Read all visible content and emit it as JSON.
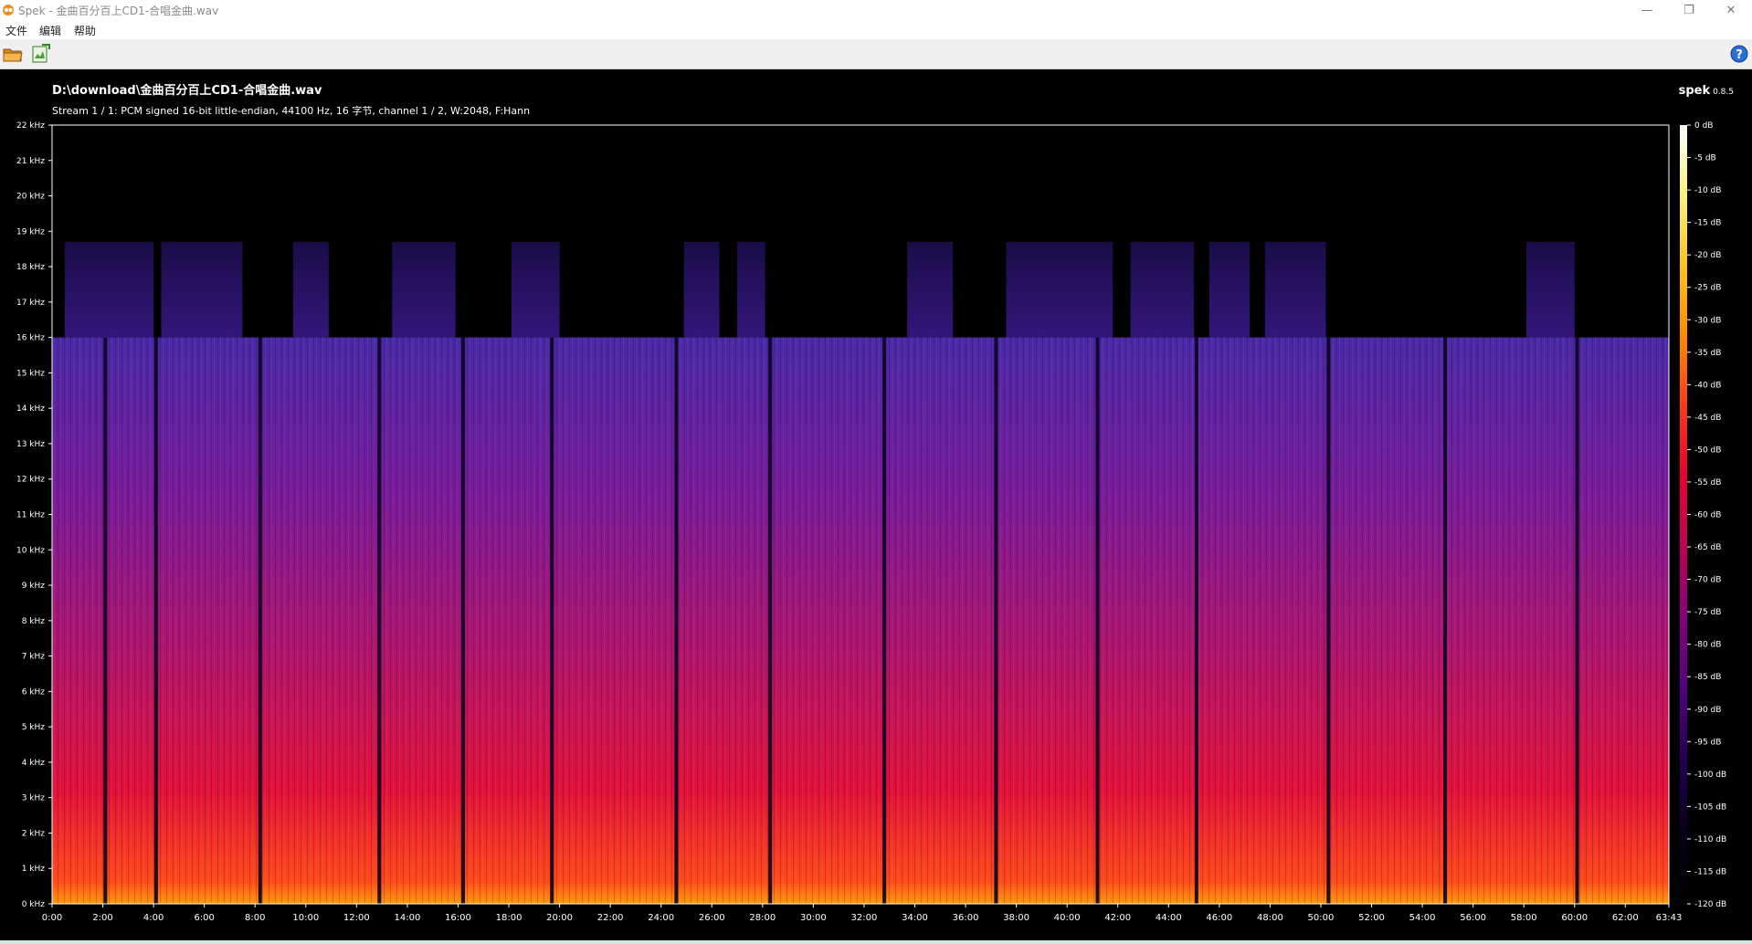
{
  "window": {
    "title": "Spek - 金曲百分百上CD1-合唱金曲.wav",
    "icon": "spek-app-icon",
    "controls": {
      "minimize": "—",
      "restore": "❐",
      "close": "✕"
    }
  },
  "menu": {
    "items": [
      "文件",
      "编辑",
      "帮助"
    ]
  },
  "toolbar": {
    "buttons": [
      {
        "name": "open-file-icon",
        "tooltip": ""
      },
      {
        "name": "save-image-icon",
        "tooltip": ""
      }
    ],
    "help": "help-icon"
  },
  "header": {
    "file_path": "D:\\download\\金曲百分百上CD1-合唱金曲.wav",
    "stream_info": "Stream 1 / 1: PCM signed 16-bit little-endian, 44100 Hz, 16 字节, channel 1 / 2, W:2048, F:Hann",
    "brand": "spek",
    "version": "0.8.5"
  },
  "chart_data": {
    "type": "heatmap",
    "title": "",
    "y_axis": {
      "unit": "kHz",
      "ticks": [
        "0 kHz",
        "1 kHz",
        "2 kHz",
        "3 kHz",
        "4 kHz",
        "5 kHz",
        "6 kHz",
        "7 kHz",
        "8 kHz",
        "9 kHz",
        "10 kHz",
        "11 kHz",
        "12 kHz",
        "13 kHz",
        "14 kHz",
        "15 kHz",
        "16 kHz",
        "17 kHz",
        "18 kHz",
        "19 kHz",
        "20 kHz",
        "21 kHz",
        "22 kHz"
      ],
      "range": [
        0,
        22
      ]
    },
    "x_axis": {
      "ticks": [
        "0:00",
        "2:00",
        "4:00",
        "6:00",
        "8:00",
        "10:00",
        "12:00",
        "14:00",
        "16:00",
        "18:00",
        "20:00",
        "22:00",
        "24:00",
        "26:00",
        "28:00",
        "30:00",
        "32:00",
        "34:00",
        "36:00",
        "38:00",
        "40:00",
        "42:00",
        "44:00",
        "46:00",
        "48:00",
        "50:00",
        "52:00",
        "54:00",
        "56:00",
        "58:00",
        "60:00",
        "62:00",
        "63:43"
      ],
      "range_seconds": [
        0,
        3823
      ]
    },
    "color_scale": {
      "unit": "dB",
      "range": [
        -120,
        0
      ],
      "ticks": [
        "0 dB",
        "-5 dB",
        "-10 dB",
        "-15 dB",
        "-20 dB",
        "-25 dB",
        "-30 dB",
        "-35 dB",
        "-40 dB",
        "-45 dB",
        "-50 dB",
        "-55 dB",
        "-60 dB",
        "-65 dB",
        "-70 dB",
        "-75 dB",
        "-80 dB",
        "-85 dB",
        "-90 dB",
        "-95 dB",
        "-100 dB",
        "-105 dB",
        "-110 dB",
        "-115 dB",
        "-120 dB"
      ],
      "colors": [
        "#ffffff",
        "#fff07a",
        "#ffc21f",
        "#ff8a00",
        "#ff3a1a",
        "#e8002e",
        "#b8005a",
        "#80007e",
        "#4e0080",
        "#200050",
        "#06001a",
        "#000000"
      ]
    },
    "lowpass_cutoff_khz": 16,
    "track_boundaries_min": [
      2.1,
      4.1,
      8.2,
      12.9,
      16.2,
      19.7,
      24.6,
      28.3,
      32.8,
      37.2,
      41.2,
      45.1,
      50.3,
      54.9,
      60.1
    ],
    "high_band_segments_min": [
      [
        0.5,
        4.0
      ],
      [
        4.3,
        7.5
      ],
      [
        9.5,
        10.9
      ],
      [
        13.4,
        15.9
      ],
      [
        18.1,
        20.0
      ],
      [
        24.9,
        26.3
      ],
      [
        27.0,
        28.1
      ],
      [
        33.7,
        35.5
      ],
      [
        37.6,
        41.8
      ],
      [
        42.5,
        45.0
      ],
      [
        45.6,
        47.2
      ],
      [
        47.8,
        50.2
      ],
      [
        58.1,
        60.0
      ]
    ]
  }
}
